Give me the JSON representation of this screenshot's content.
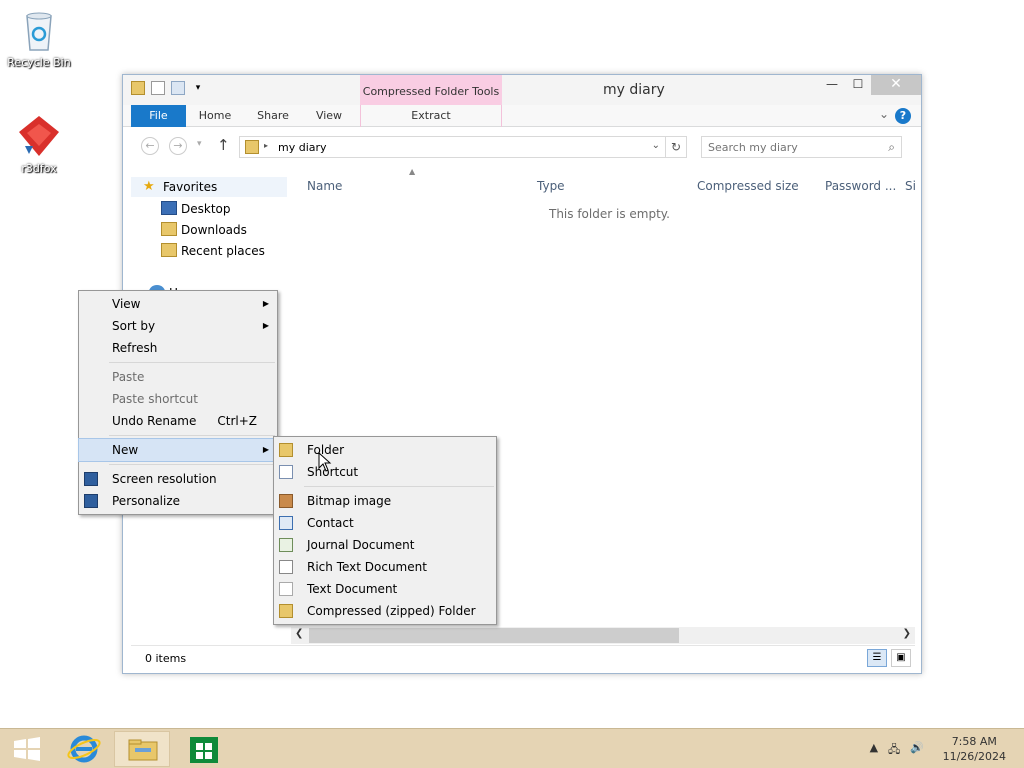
{
  "desktop": {
    "icons": [
      {
        "label": "Recycle Bin",
        "icon": "recycle-bin-icon"
      },
      {
        "label": "r3dfox",
        "icon": "r3dfox-app-icon"
      }
    ]
  },
  "window": {
    "title": "my diary",
    "contextual_tab_group": "Compressed Folder Tools",
    "ribbon_tabs": [
      "File",
      "Home",
      "Share",
      "View",
      "Extract"
    ],
    "address": {
      "path": "my diary"
    },
    "search": {
      "placeholder": "Search my diary"
    },
    "nav_pane": {
      "favorites": "Favorites",
      "items": [
        "Desktop",
        "Downloads",
        "Recent places"
      ],
      "homegroup": "Homegroup"
    },
    "columns": [
      "Name",
      "Type",
      "Compressed size",
      "Password ...",
      "Si"
    ],
    "empty_message": "This folder is empty.",
    "status": {
      "item_count": "0 items"
    },
    "accent_color": "#1979ca",
    "contextual_color": "#f9cde3"
  },
  "context_menu": {
    "groups": [
      [
        {
          "label": "View",
          "submenu": true,
          "enabled": true
        },
        {
          "label": "Sort by",
          "submenu": true,
          "enabled": true
        },
        {
          "label": "Refresh",
          "submenu": false,
          "enabled": true
        }
      ],
      [
        {
          "label": "Paste",
          "enabled": false
        },
        {
          "label": "Paste shortcut",
          "enabled": false
        },
        {
          "label": "Undo Rename",
          "shortcut": "Ctrl+Z",
          "enabled": true
        }
      ],
      [
        {
          "label": "New",
          "submenu": true,
          "enabled": true,
          "highlighted": true
        }
      ],
      [
        {
          "label": "Screen resolution",
          "icon": "screen-resolution-icon",
          "enabled": true
        },
        {
          "label": "Personalize",
          "icon": "personalize-icon",
          "enabled": true
        }
      ]
    ]
  },
  "new_submenu": {
    "groups": [
      [
        {
          "label": "Folder",
          "icon": "folder-icon"
        },
        {
          "label": "Shortcut",
          "icon": "shortcut-icon"
        }
      ],
      [
        {
          "label": "Bitmap image",
          "icon": "bitmap-image-icon"
        },
        {
          "label": "Contact",
          "icon": "contact-icon"
        },
        {
          "label": "Journal Document",
          "icon": "journal-document-icon"
        },
        {
          "label": "Rich Text Document",
          "icon": "rich-text-document-icon"
        },
        {
          "label": "Text Document",
          "icon": "text-document-icon"
        },
        {
          "label": "Compressed (zipped) Folder",
          "icon": "zipped-folder-icon"
        }
      ]
    ]
  },
  "taskbar": {
    "clock": {
      "time": "7:58 AM",
      "date": "11/26/2024"
    }
  }
}
